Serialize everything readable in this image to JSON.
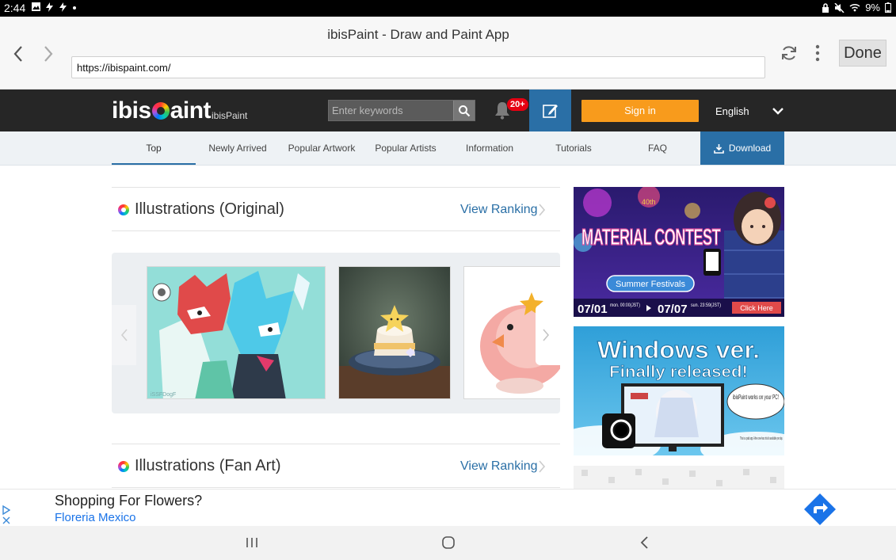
{
  "status_bar": {
    "time": "2:44",
    "battery": "9%"
  },
  "browser": {
    "page_title": "ibisPaint - Draw and Paint App",
    "url": "https://ibispaint.com/",
    "done_label": "Done"
  },
  "site_header": {
    "logo_text_left": "ibis",
    "logo_text_right": "aint",
    "logo_sub": "ibisPaint",
    "search_placeholder": "Enter keywords",
    "notification_badge": "20+",
    "signin_label": "Sign in",
    "language": "English"
  },
  "subnav": {
    "items": [
      "Top",
      "Newly Arrived",
      "Popular Artwork",
      "Popular Artists",
      "Information",
      "Tutorials",
      "FAQ"
    ],
    "download_label": "Download"
  },
  "sections": [
    {
      "title": "Illustrations (Original)",
      "view_ranking": "View Ranking"
    },
    {
      "title": "Illustrations (Fan Art)",
      "view_ranking": "View Ranking"
    }
  ],
  "banners": {
    "contest_text": "MATERIAL CONTEST",
    "contest_sub": "Summer Festivals",
    "contest_anniv": "40th",
    "contest_date_start": "07/01",
    "contest_date_start_detail": "mon. 00:00(JST)",
    "contest_date_end": "07/07",
    "contest_date_end_detail": "sun. 23:59(JST)",
    "contest_cta": "Click Here",
    "windows_line1": "Windows ver.",
    "windows_line2": "Finally released!",
    "windows_bubble": "ibisPaint works on your PC!",
    "windows_note": "This is a paid app. A free one-hour trial is available per day."
  },
  "ad": {
    "headline": "Shopping For Flowers?",
    "advertiser": "Floreria Mexico"
  },
  "colors": {
    "header_bg": "#262626",
    "accent_blue": "#2a6fa6",
    "signin_orange": "#f89b1c",
    "badge_red": "#e60012",
    "ad_link": "#1a73e8"
  }
}
